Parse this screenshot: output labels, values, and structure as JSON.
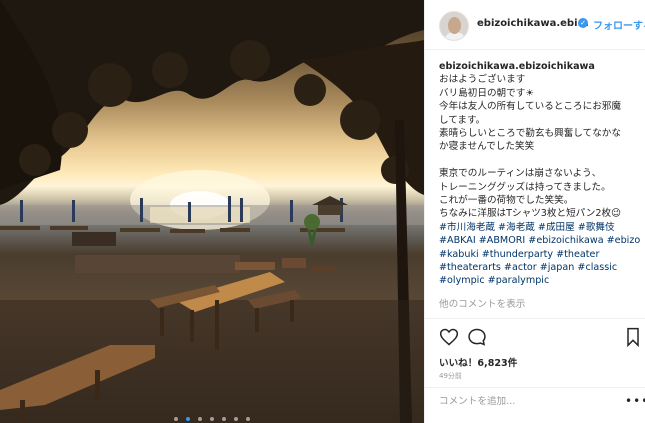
{
  "post": {
    "username": "ebizoichikawa.ebi...",
    "follow_label": "フォローする",
    "carousel": {
      "count": 7,
      "active": 1
    }
  },
  "caption": {
    "username": "ebizoichikawa.ebizoichikawa",
    "lines": [
      "おはようございます",
      "バリ島初日の朝です☀",
      "今年は友人の所有しているところにお邪魔",
      "してます。",
      "素晴らしいところで勸玄も興奮してなかな",
      "か寝ませんでした笑笑",
      "",
      "東京でのルーティンは崩さないよう、",
      "トレーニンググッズは持ってきました。",
      "これが一番の荷物でした笑笑。",
      "ちなみに洋服はTシャツ3枚と短パン2枚😉"
    ],
    "hashtags": [
      "#市川海老蔵 #海老蔵 #成田屋 #歌舞伎",
      "#ABKAI #ABMORI #ebizoichikawa #ebizo",
      "#kabuki #thunderparty #theater",
      "#theaterarts #actor #japan #classic",
      "#olympic #paralympic"
    ],
    "more_comments": "他のコメントを表示"
  },
  "engagement": {
    "likes": "いいね！6,823件",
    "time": "49分前"
  },
  "comment_box": {
    "placeholder": "コメントを追加..."
  },
  "icons": {
    "like": "heart-icon",
    "comment": "speech-bubble-icon",
    "save": "bookmark-icon",
    "verified": "verified-badge-icon",
    "menu": "more-options-icon"
  },
  "colors": {
    "link": "#3897f0",
    "hashtag": "#003569",
    "muted": "#999999",
    "border": "#efefef"
  }
}
